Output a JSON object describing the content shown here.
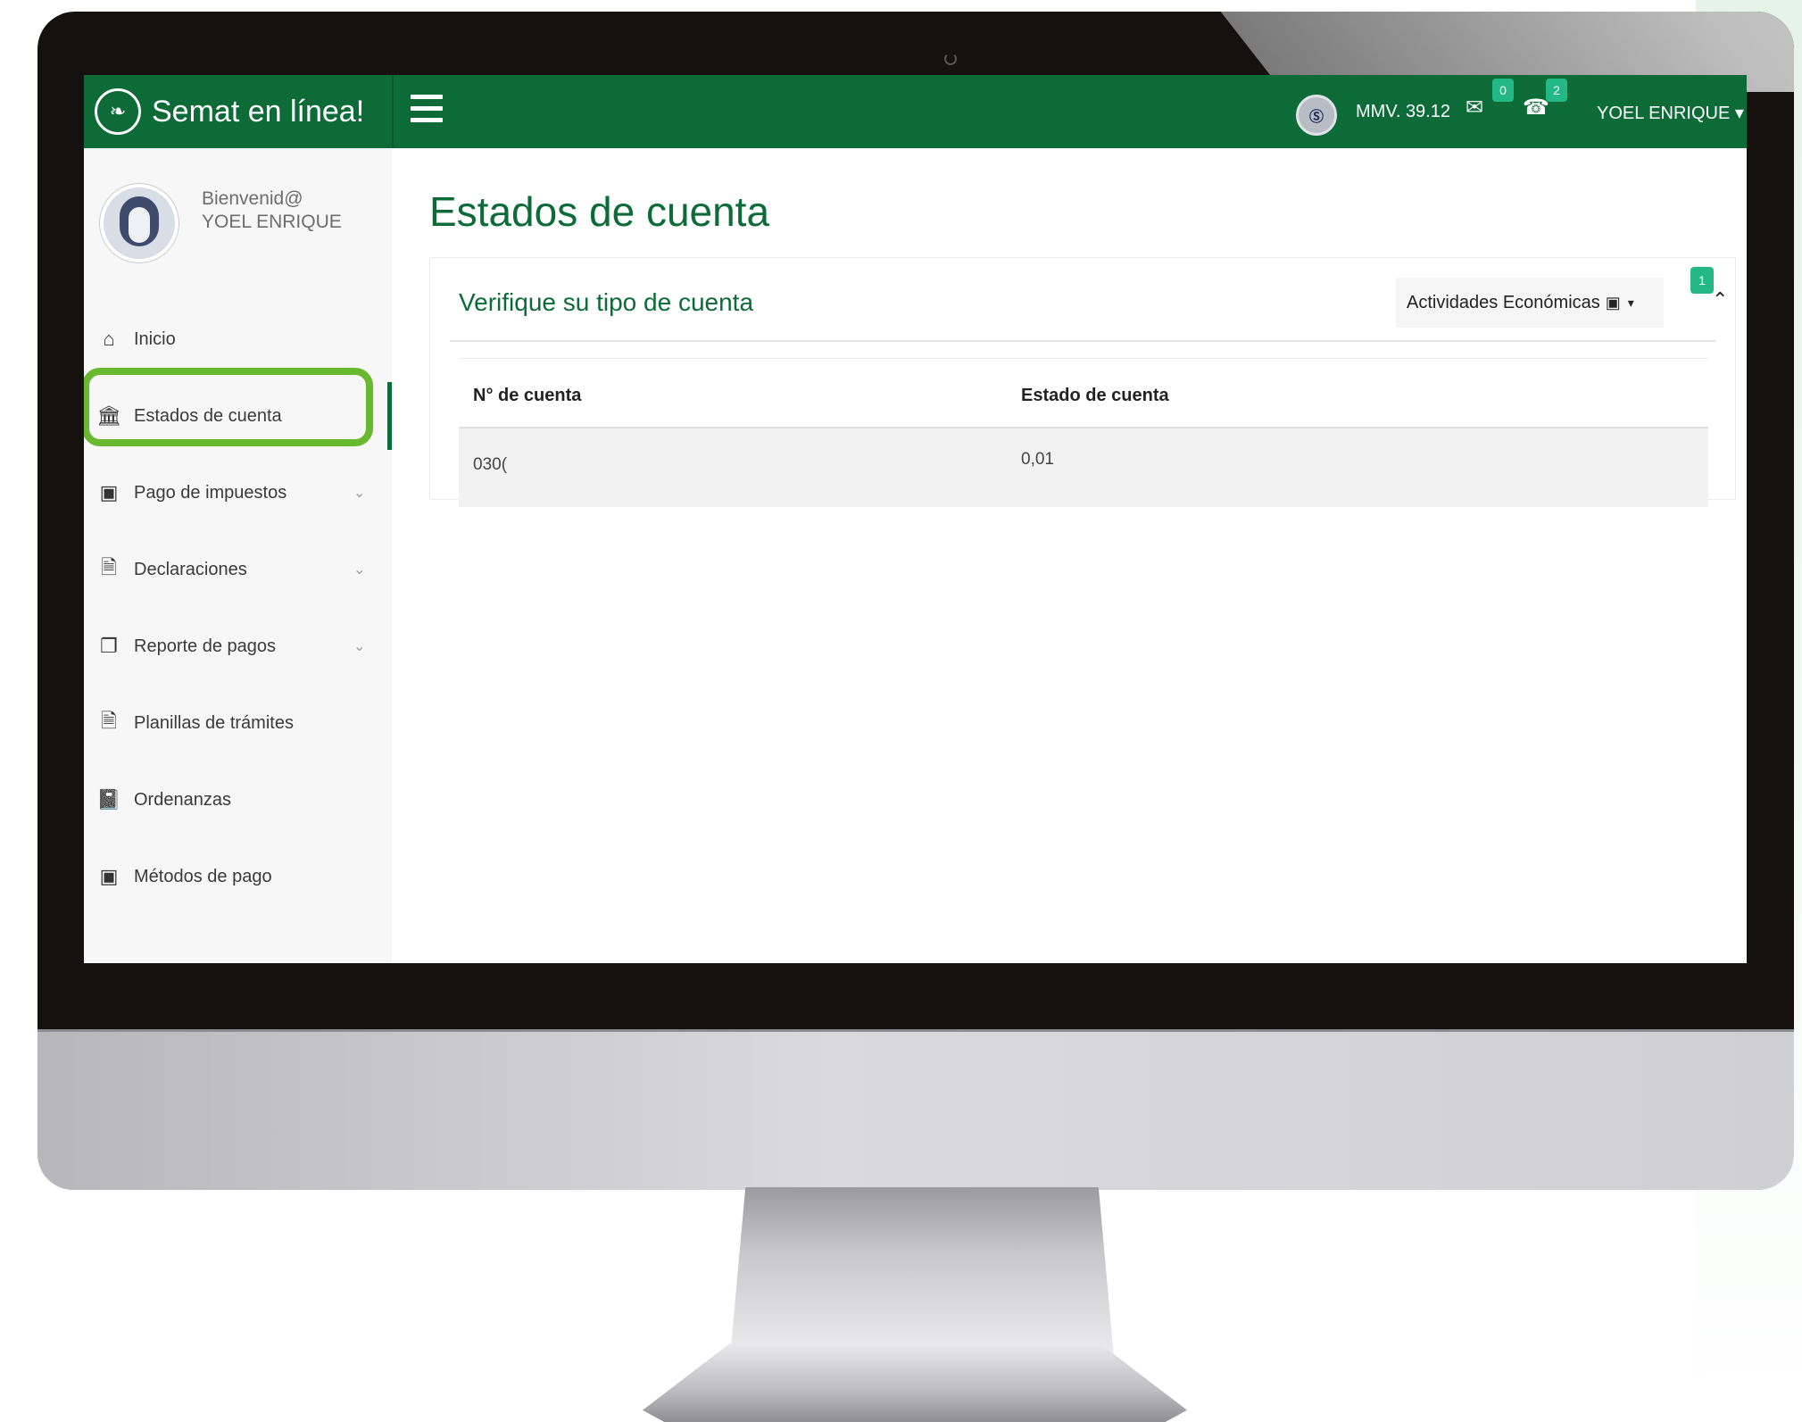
{
  "app": {
    "title": "Semat en línea!",
    "logo_icon": "leaf-icon"
  },
  "header": {
    "menu_icon": "hamburger-icon",
    "mmv_label": "MMV. 39.12",
    "mail_badge": "0",
    "phone_badge": "2",
    "user_name": "YOEL ENRIQUE ▾"
  },
  "sidebar": {
    "welcome_line1": "Bienvenid@",
    "welcome_line2": "YOEL ENRIQUE",
    "items": [
      {
        "label": "Inicio",
        "icon": "home-icon",
        "has_submenu": false
      },
      {
        "label": "Estados de cuenta",
        "icon": "bank-icon",
        "has_submenu": false,
        "active": true
      },
      {
        "label": "Pago de impuestos",
        "icon": "money-icon",
        "has_submenu": true
      },
      {
        "label": "Declaraciones",
        "icon": "document-icon",
        "has_submenu": true
      },
      {
        "label": "Reporte de pagos",
        "icon": "copy-icon",
        "has_submenu": true
      },
      {
        "label": "Planillas de trámites",
        "icon": "document-icon",
        "has_submenu": false
      },
      {
        "label": "Ordenanzas",
        "icon": "book-icon",
        "has_submenu": false
      },
      {
        "label": "Métodos de pago",
        "icon": "money-icon",
        "has_submenu": false
      }
    ]
  },
  "main": {
    "page_title": "Estados de cuenta",
    "card_title": "Verifique su tipo de cuenta",
    "dropdown_label": "Actividades Económicas",
    "dropdown_badge": "1",
    "table": {
      "headers": [
        "N° de cuenta",
        "Estado de cuenta"
      ],
      "rows": [
        [
          "030(",
          "0,01"
        ]
      ]
    }
  },
  "colors": {
    "brand_green": "#0d6b38",
    "badge_teal": "#23b886",
    "highlight_green": "#68b830"
  }
}
